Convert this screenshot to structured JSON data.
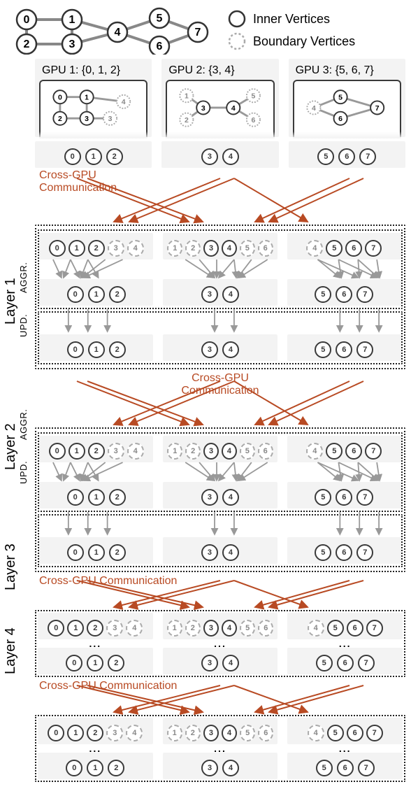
{
  "legend": {
    "inner": "Inner Vertices",
    "boundary": "Boundary Vertices"
  },
  "global_graph": {
    "vertices": [
      0,
      1,
      2,
      3,
      4,
      5,
      6,
      7
    ],
    "edges": [
      [
        0,
        1
      ],
      [
        0,
        2
      ],
      [
        1,
        3
      ],
      [
        1,
        4
      ],
      [
        2,
        3
      ],
      [
        3,
        4
      ],
      [
        4,
        5
      ],
      [
        4,
        6
      ],
      [
        5,
        7
      ],
      [
        6,
        7
      ]
    ]
  },
  "gpus": [
    {
      "title": "GPU 1: {0, 1, 2}",
      "inner": [
        0,
        1,
        2
      ],
      "boundary": [
        3,
        4
      ]
    },
    {
      "title": "GPU 2: {3, 4}",
      "inner": [
        3,
        4
      ],
      "boundary": [
        1,
        2,
        5,
        6
      ]
    },
    {
      "title": "GPU 3: {5, 6, 7}",
      "inner": [
        5,
        6,
        7
      ],
      "boundary": [
        4
      ]
    }
  ],
  "labels": {
    "layer1": "Layer 1",
    "layer2": "Layer 2",
    "layer3": "Layer 3",
    "layer4": "Layer 4",
    "aggr": "AGGR.",
    "upd": "UPD.",
    "comm": "Cross-GPU",
    "comm2": "Communication",
    "ellipsis": "..."
  },
  "row_configs": {
    "gpu1_inner": [
      {
        "v": 0,
        "t": "s"
      },
      {
        "v": 1,
        "t": "s"
      },
      {
        "v": 2,
        "t": "s"
      }
    ],
    "gpu1_full": [
      {
        "v": 0,
        "t": "s"
      },
      {
        "v": 1,
        "t": "s"
      },
      {
        "v": 2,
        "t": "s"
      },
      {
        "v": 3,
        "t": "d"
      },
      {
        "v": 4,
        "t": "d"
      }
    ],
    "gpu2_inner": [
      {
        "v": 3,
        "t": "s"
      },
      {
        "v": 4,
        "t": "s"
      }
    ],
    "gpu2_full": [
      {
        "v": 1,
        "t": "d"
      },
      {
        "v": 2,
        "t": "d"
      },
      {
        "v": 3,
        "t": "s"
      },
      {
        "v": 4,
        "t": "s"
      },
      {
        "v": 5,
        "t": "d"
      },
      {
        "v": 6,
        "t": "d"
      }
    ],
    "gpu3_inner": [
      {
        "v": 5,
        "t": "s"
      },
      {
        "v": 6,
        "t": "s"
      },
      {
        "v": 7,
        "t": "s"
      }
    ],
    "gpu3_full": [
      {
        "v": 4,
        "t": "d"
      },
      {
        "v": 5,
        "t": "s"
      },
      {
        "v": 6,
        "t": "s"
      },
      {
        "v": 7,
        "t": "s"
      }
    ]
  }
}
